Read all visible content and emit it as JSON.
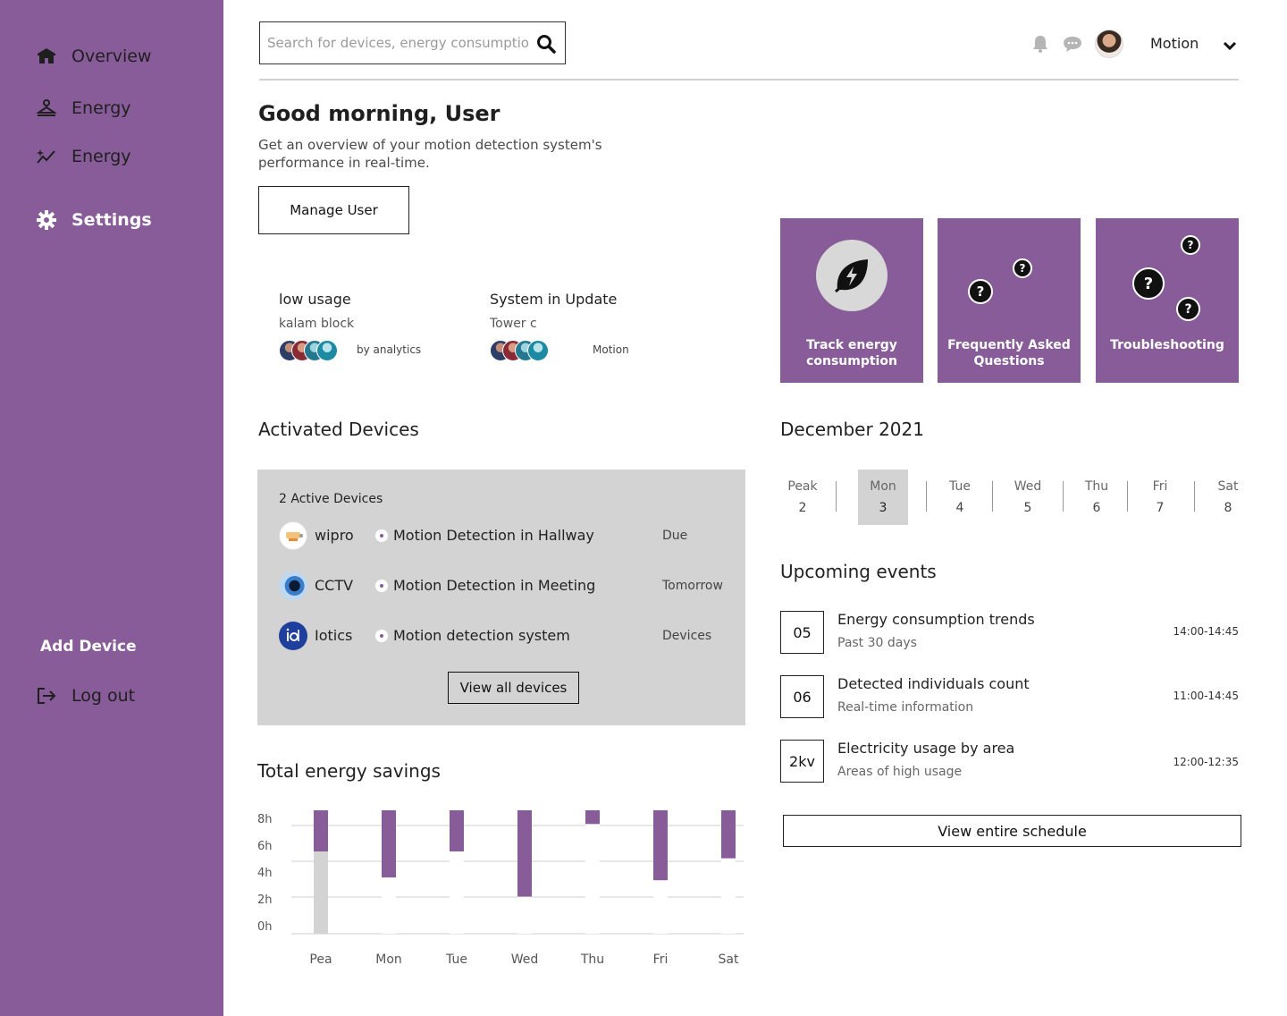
{
  "sidebar": {
    "items": [
      {
        "label": "Overview",
        "icon": "home-icon"
      },
      {
        "label": "Energy",
        "icon": "hanger-icon"
      },
      {
        "label": "Energy",
        "icon": "sparkle-chart-icon"
      },
      {
        "label": "Settings",
        "icon": "gear-icon"
      }
    ],
    "add_device": "Add Device",
    "logout": "Log out"
  },
  "header": {
    "search_placeholder": "Search for devices, energy consumption...",
    "user_name": "Motion"
  },
  "greeting": {
    "title": "Good morning, User",
    "subtitle": "Get an overview of your motion detection system's performance in real-time.",
    "manage_button": "Manage User"
  },
  "summaries": [
    {
      "title": "low usage",
      "subtitle": "kalam block",
      "note": "by analytics"
    },
    {
      "title": "System in Update",
      "subtitle": "Tower c",
      "note": "Motion"
    }
  ],
  "tiles": [
    {
      "label": "Track energy consumption",
      "icon": "energy-leaf-icon"
    },
    {
      "label": "Frequently Asked Questions",
      "icon": "question-icon"
    },
    {
      "label": "Troubleshooting",
      "icon": "question-icon"
    }
  ],
  "devices": {
    "title": "Activated Devices",
    "count_label": "2 Active Devices",
    "rows": [
      {
        "name": "wipro",
        "description": "Motion Detection in Hallway",
        "status": "Due"
      },
      {
        "name": "CCTV",
        "description": "Motion Detection in Meeting",
        "status": "Tomorrow"
      },
      {
        "name": "Iotics",
        "description": "Motion detection system",
        "status": "Devices"
      }
    ],
    "view_all": "View all devices"
  },
  "energy": {
    "title": "Total energy savings"
  },
  "chart_data": {
    "type": "bar",
    "title": "Total energy savings",
    "categories": [
      "Pea",
      "Mon",
      "Tue",
      "Wed",
      "Thu",
      "Fri",
      "Sat"
    ],
    "y_ticks": [
      "8h",
      "6h",
      "4h",
      "2h",
      "0h"
    ],
    "ylim": [
      0,
      9
    ],
    "grid": true,
    "series": [
      {
        "values": [
          9.0,
          9.0,
          9.0,
          9.0,
          9.0,
          9.0,
          9.0
        ],
        "color": "#875c99"
      },
      {
        "values": [
          6.0,
          4.1,
          6.0,
          2.7,
          8.0,
          3.9,
          5.5
        ],
        "color": "#ffffff"
      }
    ],
    "highlight_fill": "#d3d3d3"
  },
  "calendar": {
    "month": "December 2021",
    "days": [
      {
        "name": "Peak",
        "date": "2"
      },
      {
        "name": "Mon",
        "date": "3"
      },
      {
        "name": "Tue",
        "date": "4"
      },
      {
        "name": "Wed",
        "date": "5"
      },
      {
        "name": "Thu",
        "date": "6"
      },
      {
        "name": "Fri",
        "date": "7"
      },
      {
        "name": "Sat",
        "date": "8"
      }
    ]
  },
  "events": {
    "title": "Upcoming events",
    "items": [
      {
        "badge": "05",
        "title": "Energy consumption trends",
        "subtitle": "Past 30 days",
        "time": "14:00-14:45"
      },
      {
        "badge": "06",
        "title": "Detected individuals count",
        "subtitle": "Real-time information",
        "time": "11:00-14:45"
      },
      {
        "badge": "2kv",
        "title": "Electricity usage by area",
        "subtitle": "Areas of high usage",
        "time": "12:00-12:35"
      }
    ],
    "view_schedule": "View entire schedule"
  },
  "colors": {
    "brand": "#875c99",
    "panel_gray": "#d3d3d3"
  }
}
